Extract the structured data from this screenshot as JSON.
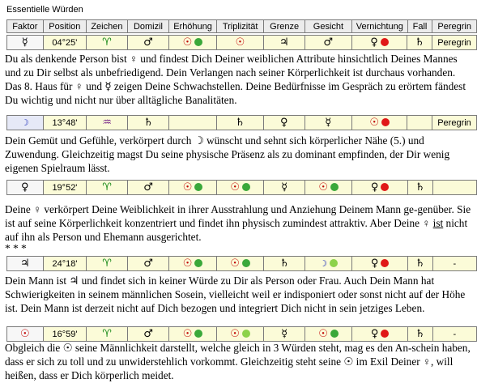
{
  "section_title": "Essentielle Würden",
  "headers": [
    "Faktor",
    "Position",
    "Zeichen",
    "Domizil",
    "Erhöhung",
    "Triplizität",
    "Grenze",
    "Gesicht",
    "Vernichtung",
    "Fall",
    "Peregrin"
  ],
  "rows": [
    {
      "faktor": "☿",
      "position": "04°25'",
      "zeichen": "♈",
      "domizil": "♂",
      "erhoehung": "☉",
      "triplizitaet": "☉",
      "grenze": "♃",
      "gesicht": "♂",
      "vernichtung": "♀",
      "fall": "♄",
      "peregrin": "Peregrin"
    },
    {
      "faktor": "☽",
      "position": "13°48'",
      "zeichen": "♒",
      "domizil": "♄",
      "erhoehung": "",
      "triplizitaet": "♄",
      "grenze": "♀",
      "gesicht": "☿",
      "vernichtung": "☉",
      "fall": "",
      "peregrin": "Peregrin"
    },
    {
      "faktor": "♀",
      "position": "19°52'",
      "zeichen": "♈",
      "domizil": "♂",
      "erhoehung": "☉",
      "triplizitaet": "☉",
      "grenze": "☿",
      "gesicht": "☉",
      "vernichtung": "♀",
      "fall": "♄",
      "peregrin": ""
    },
    {
      "faktor": "♃",
      "position": "24°18'",
      "zeichen": "♈",
      "domizil": "♂",
      "erhoehung": "☉",
      "triplizitaet": "☉",
      "grenze": "♄",
      "gesicht": "☽",
      "vernichtung": "♀",
      "fall": "♄",
      "peregrin": "-"
    },
    {
      "faktor": "☉",
      "position": "16°59'",
      "zeichen": "♈",
      "domizil": "♂",
      "erhoehung": "☉",
      "triplizitaet": "☉",
      "grenze": "☿",
      "gesicht": "☉",
      "vernichtung": "♀",
      "fall": "♄",
      "peregrin": "-"
    }
  ],
  "paragraphs": {
    "p1": "Du als denkende Person bist ♀ und findest Dich Deiner weiblichen Attribute hinsichtlich Deines Mannes und zu Dir selbst als unbefriedigend. Dein Verlangen nach seiner Körperlichkeit ist durchaus vorhanden. Das 8. Haus für ♀ und ☿ zeigen Deine Schwachstellen. Deine Bedürfnisse im Gespräch zu erörtem fändest Du wichtig und nicht nur über alltägliche Banalitäten.",
    "p2": "Dein Gemüt und Gefühle, verkörpert durch ☽ wünscht und sehnt sich körperlicher Nähe (5.) und Zuwendung. Gleichzeitig magst Du seine physische Präsenz als zu dominant empfinden, der Dir wenig eigenen Spielraum lässt.",
    "p3a": "Deine ♀ verkörpert Deine Weiblichkeit in ihrer Ausstrahlung und Anziehung Deinem Mann ge-genüber. Sie ist auf seine Körperlichkeit konzentriert und findet ihn physisch zumindest attraktiv. Aber Deine ♀ ",
    "p3u": "ist",
    "p3b": " nicht auf ihn als Person und Ehemann ausgerichtet.",
    "sep": "* * *",
    "p4": "Dein Mann ist ♃ und findet sich in keiner Würde zu Dir als Person oder Frau. Auch Dein Mann hat Schwierigkeiten in seinem männlichen Sosein, vielleicht weil er indisponiert oder sonst nicht auf der Höhe ist. Dein Mann ist derzeit nicht auf Dich bezogen und integriert Dich nicht in sein jetziges Leben.",
    "p5": "Obgleich die ☉ seine Männlichkeit darstellt, welche gleich in 3 Würden steht, mag es den An-schein haben, dass er sich zu toll und zu unwiderstehlich vorkommt. Gleichzeitig steht seine ☉ im Exil Deiner ♀, will heißen, dass er Dich körperlich meidet."
  }
}
